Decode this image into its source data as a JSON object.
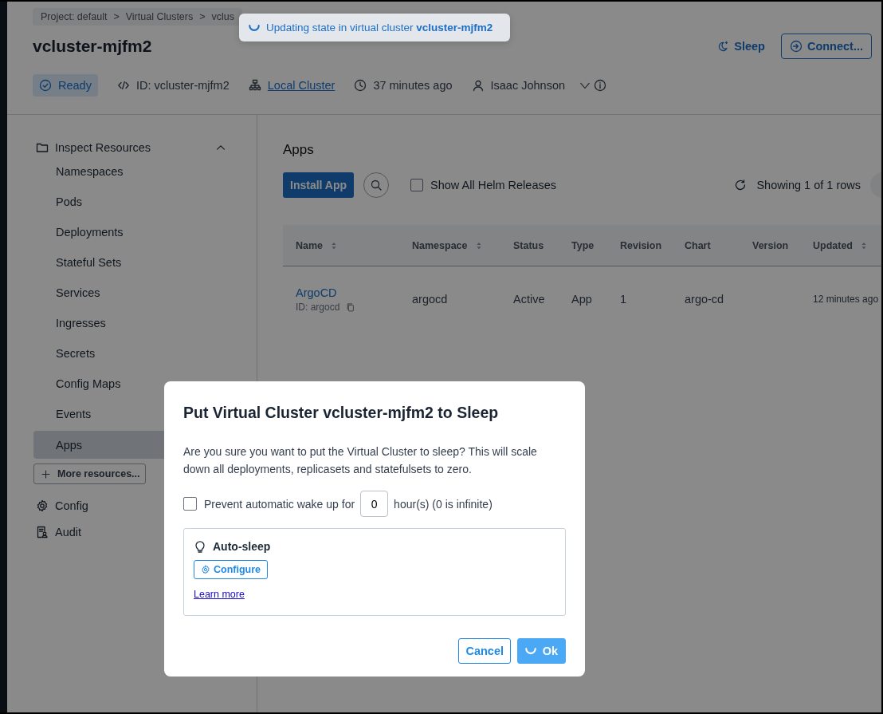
{
  "breadcrumb": {
    "items": [
      "Project: default",
      "Virtual Clusters",
      "vclus"
    ],
    "separator": ">"
  },
  "toast": {
    "text": "Updating state in virtual cluster **vcluster-mjfm2**",
    "loading": true
  },
  "header": {
    "title": "vcluster-mjfm2",
    "actions": [
      {
        "label": "Sleep",
        "kind": "link"
      },
      {
        "label": "Connect...",
        "kind": "outline"
      }
    ],
    "meta": [
      {
        "kind": "status",
        "text": "Ready"
      },
      {
        "kind": "id",
        "text": "ID: vcluster-mjfm2"
      },
      {
        "kind": "cluster",
        "text": "Local Cluster"
      },
      {
        "kind": "time",
        "text": "37 minutes ago"
      },
      {
        "kind": "user",
        "text": "Isaac Johnson"
      }
    ]
  },
  "sidebar": {
    "groups": [
      {
        "label": "Inspect Resources",
        "expanded": true,
        "children": [
          {
            "label": "Namespaces",
            "selected": false
          },
          {
            "label": "Pods",
            "selected": false
          },
          {
            "label": "Deployments",
            "selected": false
          },
          {
            "label": "Stateful Sets",
            "selected": false
          },
          {
            "label": "Services",
            "selected": false
          },
          {
            "label": "Ingresses",
            "selected": false
          },
          {
            "label": "Secrets",
            "selected": false
          },
          {
            "label": "Config Maps",
            "selected": false
          },
          {
            "label": "Events",
            "selected": false
          },
          {
            "label": "Apps",
            "selected": true
          }
        ]
      }
    ],
    "more_button": "More resources...",
    "items": [
      {
        "label": "Config",
        "kind": "config"
      },
      {
        "label": "Audit",
        "kind": "audit"
      }
    ]
  },
  "apps": {
    "title": "Apps",
    "install_button": "Install App",
    "show_all": {
      "label": "Show All Helm Releases",
      "checked": false
    },
    "row_count": "Showing 1 of 1 rows",
    "table": {
      "columns": [
        {
          "label": "Name",
          "sortable": true
        },
        {
          "label": "Namespace",
          "sortable": true
        },
        {
          "label": "Status",
          "sortable": false
        },
        {
          "label": "Type",
          "sortable": false
        },
        {
          "label": "Revision",
          "sortable": false
        },
        {
          "label": "Chart",
          "sortable": false
        },
        {
          "label": "Version",
          "sortable": false
        },
        {
          "label": "Updated",
          "sortable": true
        }
      ],
      "rows": [
        {
          "name": "ArgoCD",
          "id": "ID: argocd",
          "namespace": "argocd",
          "status": "Active",
          "type": "App",
          "revision": "1",
          "chart": "argo-cd",
          "updated": "12 minutes ago"
        }
      ]
    }
  },
  "dialog": {
    "title": "Put Virtual Cluster vcluster-mjfm2 to Sleep",
    "message": "Are you sure you want to put the Virtual Cluster to sleep? This will scale down all deployments, replicasets and statefulsets to zero.",
    "prevent": {
      "label": "Prevent automatic wake up for",
      "value": "0",
      "suffix": "hour(s) (0 is infinite)",
      "checked": false
    },
    "auto_sleep": {
      "title": "Auto-sleep",
      "configure": "Configure",
      "learn_more": "Learn more"
    },
    "buttons": [
      {
        "label": "Cancel",
        "kind": "secondary",
        "loading": false
      },
      {
        "label": "Ok",
        "kind": "primary",
        "loading": true
      }
    ]
  }
}
